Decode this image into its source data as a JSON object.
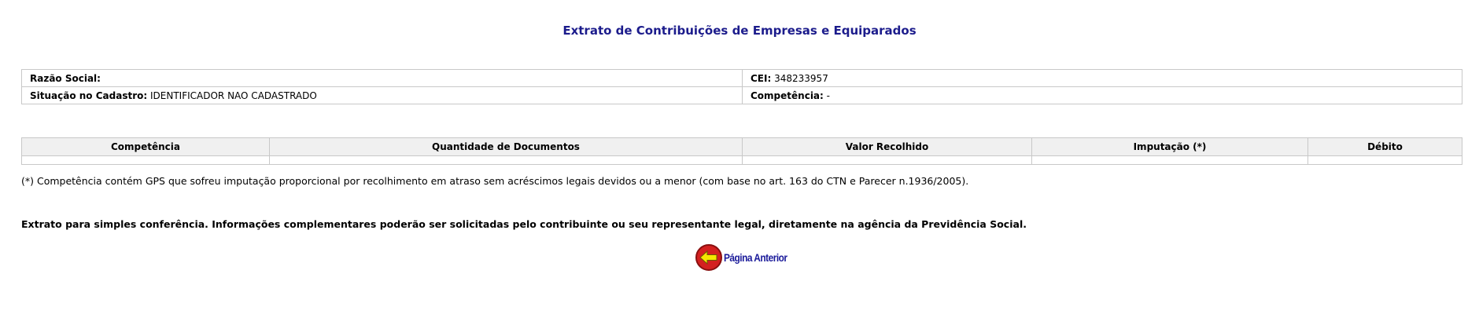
{
  "page": {
    "title": "Extrato de Contribuições de Empresas e Equiparados"
  },
  "info": {
    "razao_social_label": "Razão Social:",
    "razao_social_value": "",
    "cei_label": "CEI:",
    "cei_value": "348233957",
    "situacao_label": "Situação no Cadastro:",
    "situacao_value": "IDENTIFICADOR NAO CADASTRADO",
    "competencia_label": "Competência:",
    "competencia_value": "-"
  },
  "table": {
    "columns": [
      "Competência",
      "Quantidade de Documentos",
      "Valor Recolhido",
      "Imputação (*)",
      "Débito"
    ],
    "rows": []
  },
  "footnote": "(*) Competência contém GPS que sofreu imputação proporcional por recolhimento em atraso sem acréscimos legais devidos ou a menor (com base no art. 163 do CTN e Parecer n.1936/2005).",
  "disclaimer": "Extrato para simples conferência. Informações complementares poderão ser solicitadas pelo contribuinte ou seu representante legal, diretamente na agência da Previdência Social.",
  "back_button": {
    "label": "Página Anterior",
    "icon": "arrow-left-icon",
    "colors": {
      "circle": "#d42020",
      "arrow": "#f5e600",
      "text": "#1a1a9a"
    }
  }
}
